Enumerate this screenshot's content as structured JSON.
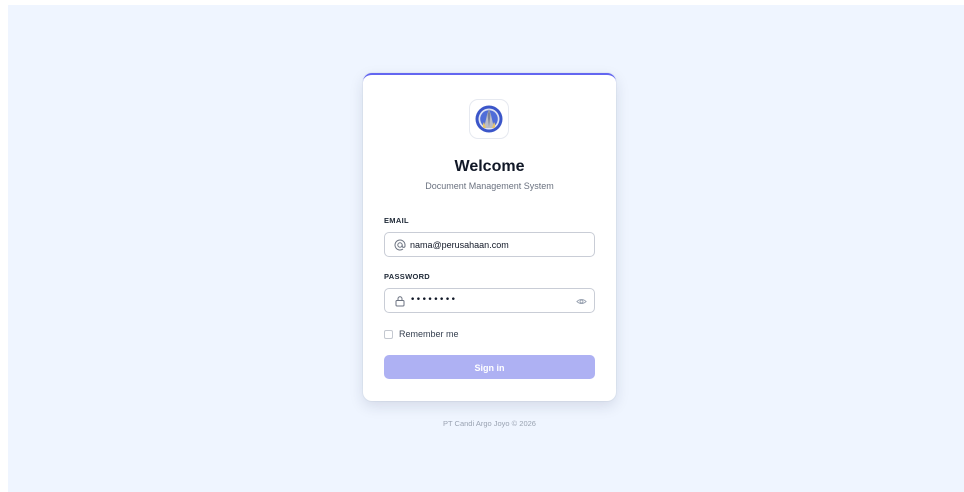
{
  "card": {
    "title": "Welcome",
    "subtitle": "Document Management System"
  },
  "form": {
    "email": {
      "label": "EMAIL",
      "value": "nama@perusahaan.com",
      "icon": "at-icon"
    },
    "password": {
      "label": "PASSWORD",
      "masked_value": "••••••••",
      "icon": "lock-icon",
      "toggle_icon": "eye-icon"
    },
    "remember_label": "Remember me",
    "remember_checked": false,
    "submit_label": "Sign in"
  },
  "footer": {
    "text": "PT Candi Argo Joyo © 2026"
  },
  "colors": {
    "page_background": "#eff5ff",
    "accent": "#6366f1",
    "button_disabled": "#aeb1f3"
  }
}
